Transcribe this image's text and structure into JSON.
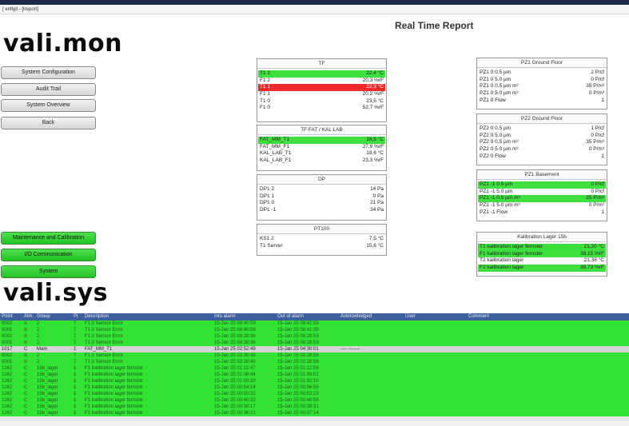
{
  "window": {
    "title": "[ enfigil - [treport]"
  },
  "brand": {
    "top": "vali.mon",
    "bottom": "vali.sys"
  },
  "page_title": "Real Time Report",
  "colors": {
    "green": "#3ee03e",
    "red": "#ee2b2b",
    "header_blue": "#3f5f9a"
  },
  "nav": {
    "system_configuration": "System Configuration",
    "audit_trail": "Audit Trail",
    "system_overview": "System Overview",
    "back": "Back",
    "maintenance": "Maintenance and Calibration",
    "io": "I/O Communication",
    "system": "System"
  },
  "panels": {
    "tf": {
      "title": "TF",
      "rows": [
        {
          "name": "T1 2",
          "value": "22,4 °C",
          "state": "green"
        },
        {
          "name": "F1 2",
          "value": "20,3 %rF",
          "state": ""
        },
        {
          "name": "T1 1",
          "value": "22,3 °C",
          "state": "red"
        },
        {
          "name": "F1 1",
          "value": "20,2 %rF",
          "state": ""
        },
        {
          "name": "T1 0",
          "value": "23,5 °C",
          "state": ""
        },
        {
          "name": "F1 0",
          "value": "52,7 %rF",
          "state": ""
        }
      ]
    },
    "tf_fat": {
      "title": "TF FAT / KAL LAB",
      "rows": [
        {
          "name": "FAT_MM_T1",
          "value": "16,5 °C",
          "state": "green"
        },
        {
          "name": "FAT_MM_F1",
          "value": "27,9 %rF",
          "state": ""
        },
        {
          "name": "KAL_LAB_T1",
          "value": "18,6 °C",
          "state": ""
        },
        {
          "name": "KAL_LAB_F1",
          "value": "23,3 %rF",
          "state": ""
        }
      ]
    },
    "dp": {
      "title": "DP",
      "rows": [
        {
          "name": "DP1 2",
          "value": "14 Pa",
          "state": ""
        },
        {
          "name": "DP1 1",
          "value": "0 Pa",
          "state": ""
        },
        {
          "name": "DP1 0",
          "value": "21 Pa",
          "state": ""
        },
        {
          "name": "DP1 -1",
          "value": "34 Pa",
          "state": ""
        }
      ]
    },
    "pt100": {
      "title": "PT100",
      "rows": [
        {
          "name": "KS1 2",
          "value": "7,5 °C",
          "state": ""
        },
        {
          "name": "T1 Server",
          "value": "15,6 °C",
          "state": ""
        }
      ]
    },
    "pz1_ground": {
      "title": "PZ1 Ground Floor",
      "rows": [
        {
          "name": "PZ1 0 0.5 µm",
          "value": "2 P/cf",
          "state": ""
        },
        {
          "name": "PZ1 0 5.0 µm",
          "value": "0 P/cf",
          "state": ""
        },
        {
          "name": "PZ1 0 0.5 µm m³",
          "value": "35 P/m³",
          "state": ""
        },
        {
          "name": "PZ1 0 5.0 µm m³",
          "value": "0 P/m³",
          "state": ""
        },
        {
          "name": "PZ1 0 Flow",
          "value": "1",
          "state": ""
        }
      ]
    },
    "pz2_ground": {
      "title": "PZ2 Ground Floor",
      "rows": [
        {
          "name": "PZ2 0 0.5 µm",
          "value": "1 P/cf",
          "state": ""
        },
        {
          "name": "PZ2 0 5.0 µm",
          "value": "0 P/cf",
          "state": ""
        },
        {
          "name": "PZ2 0 0.5 µm m³",
          "value": "35 P/m³",
          "state": ""
        },
        {
          "name": "PZ2 0 5.0 µm m³",
          "value": "0 P/m³",
          "state": ""
        },
        {
          "name": "PZ2 0 Flow",
          "value": "1",
          "state": ""
        }
      ]
    },
    "pz1_basement": {
      "title": "PZ1 Basement",
      "rows": [
        {
          "name": "PZ1 -1 0.5 µm",
          "value": "0 P/cf",
          "state": "green"
        },
        {
          "name": "PZ1 -1 5.0 µm",
          "value": "0 P/cf",
          "state": ""
        },
        {
          "name": "PZ1 -1 0.5 µm m³",
          "value": "35 P/m³",
          "state": "green"
        },
        {
          "name": "PZ1 -1 5.0 µm m³",
          "value": "0 P/m³",
          "state": ""
        },
        {
          "name": "PZ1 -1 Flow",
          "value": "1",
          "state": ""
        }
      ]
    },
    "kalibration": {
      "title": "Kalibration Lager 15b",
      "rows": [
        {
          "name": "T1 kalibration lager fernster",
          "value": "21,20 °C",
          "state": "green"
        },
        {
          "name": "F1 kalibration lager fernster",
          "value": "38,15 %rF",
          "state": "green"
        },
        {
          "name": "T2 kalibration lager",
          "value": "21,38 °C",
          "state": ""
        },
        {
          "name": "F2 kalibration lager",
          "value": "38,73 %rF",
          "state": "green"
        }
      ]
    }
  },
  "alarm_table": {
    "headers": [
      "Point",
      "Alm.",
      "Group",
      "Pr",
      "Description",
      "Into alarm",
      "Out of alarm",
      "Acknowledged",
      "User",
      "Comment"
    ],
    "rows": [
      {
        "cells": [
          "9002",
          "A",
          "2",
          "7",
          "F1 2 Sensor Error",
          "15-Jan 25 08:40:59",
          "15-Jan 25 08:41:35",
          "",
          "",
          ""
        ],
        "state": "green"
      },
      {
        "cells": [
          "9001",
          "A",
          "2",
          "7",
          "T1 2 Sensor Error",
          "15-Jan 25 08:40:59",
          "15-Jan 25 08:41:35",
          "",
          "",
          ""
        ],
        "state": "green"
      },
      {
        "cells": [
          "9002",
          "A",
          "2",
          "7",
          "F1 2 Sensor Error",
          "15-Jan 25 08:28:36",
          "15-Jan 25 08:28:53",
          "",
          "",
          ""
        ],
        "state": "green"
      },
      {
        "cells": [
          "9001",
          "A",
          "2",
          "7",
          "T1 2 Sensor Error",
          "15-Jan 25 08:28:36",
          "15-Jan 25 08:28:53",
          "",
          "",
          ""
        ],
        "state": "green"
      },
      {
        "cells": [
          "1017",
          "C",
          "Main",
          "1",
          "FAT_MM_T1",
          "15-Jan 25 02:52:49",
          "15-Jan 25 04:30:01",
          "---- -------",
          "",
          ""
        ],
        "state": "gray"
      },
      {
        "cells": [
          "9002",
          "A",
          "2",
          "7",
          "F1 2 Sensor Error",
          "15-Jan 25 02:28:40",
          "15-Jan 25 02:28:56",
          "",
          "",
          ""
        ],
        "state": "green"
      },
      {
        "cells": [
          "9001",
          "A",
          "2",
          "7",
          "T1 2 Sensor Error",
          "15-Jan 25 02:28:40",
          "15-Jan 25 02:28:56",
          "",
          "",
          ""
        ],
        "state": "green"
      },
      {
        "cells": [
          "1242",
          "C",
          "15b_lager",
          "1",
          "F1 kalibration lager fernster",
          "15-Jan 25 01:12:47",
          "15-Jan 25 01:12:59",
          "",
          "",
          ""
        ],
        "state": "green"
      },
      {
        "cells": [
          "1242",
          "C",
          "15b_lager",
          "1",
          "F1 kalibration lager fernster",
          "15-Jan 25 01:08:44",
          "15-Jan 25 01:09:51",
          "",
          "",
          ""
        ],
        "state": "green"
      },
      {
        "cells": [
          "1242",
          "C",
          "15b_lager",
          "1",
          "F1 kalibration lager fernster",
          "15-Jan 25 01:00:20",
          "15-Jan 25 01:02:10",
          "",
          "",
          ""
        ],
        "state": "green"
      },
      {
        "cells": [
          "1242",
          "C",
          "15b_lager",
          "1",
          "F1 kalibration lager fernster",
          "15-Jan 25 00:54:24",
          "15-Jan 25 00:56:55",
          "",
          "",
          ""
        ],
        "state": "green"
      },
      {
        "cells": [
          "1242",
          "C",
          "15b_lager",
          "1",
          "F1 kalibration lager fernster",
          "15-Jan 25 00:50:32",
          "15-Jan 25 00:53:23",
          "",
          "",
          ""
        ],
        "state": "green"
      },
      {
        "cells": [
          "1242",
          "C",
          "15b_lager",
          "1",
          "F1 kalibration lager fernster",
          "15-Jan 25 00:40:32",
          "15-Jan 25 00:48:58",
          "",
          "",
          ""
        ],
        "state": "green"
      },
      {
        "cells": [
          "1242",
          "C",
          "15b_lager",
          "1",
          "F1 kalibration lager fernster",
          "15-Jan 25 00:38:17",
          "15-Jan 25 00:39:31",
          "",
          "",
          ""
        ],
        "state": "green"
      },
      {
        "cells": [
          "1242",
          "C",
          "15b_lager",
          "1",
          "F1 kalibration lager fernster",
          "15-Jan 25 00:36:21",
          "15-Jan 25 00:37:14",
          "",
          "",
          ""
        ],
        "state": "green"
      }
    ]
  }
}
